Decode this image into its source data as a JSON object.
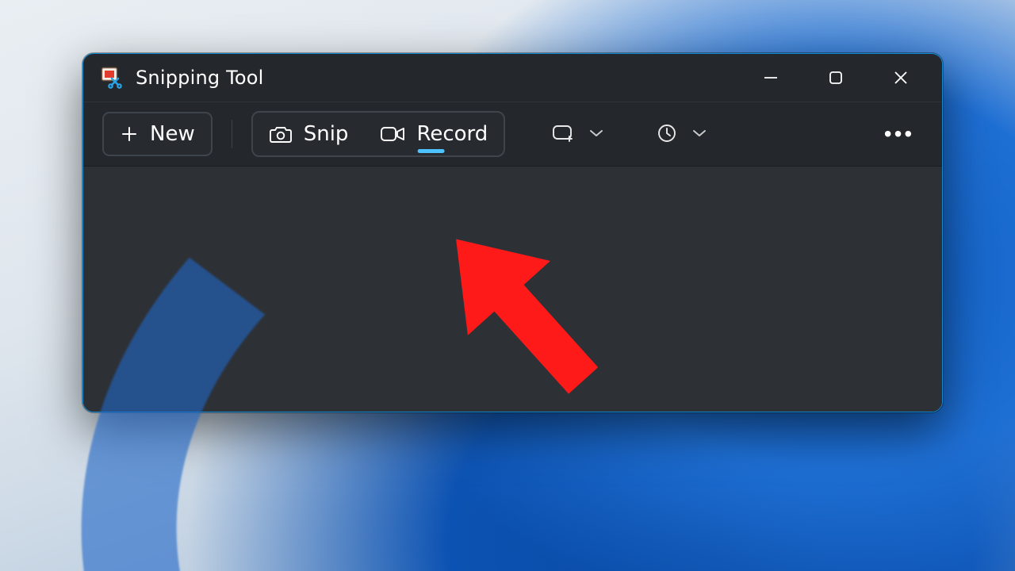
{
  "app": {
    "title": "Snipping Tool",
    "icon_name": "snipping-tool-icon"
  },
  "window_controls": {
    "minimize": "minimize",
    "maximize": "maximize",
    "close": "close"
  },
  "toolbar": {
    "new_label": "New",
    "snip_label": "Snip",
    "record_label": "Record",
    "active_mode": "record",
    "mode_dropdown": {
      "icon": "rectangle-mode-icon"
    },
    "delay_dropdown": {
      "icon": "clock-icon"
    },
    "more_label": "•••"
  },
  "annotation": {
    "arrow_color": "#ff1a1a"
  },
  "colors": {
    "accent": "#4cc2ff",
    "window_border": "#1089d1",
    "window_bg": "#24272b",
    "stage_bg": "#2d3136"
  }
}
